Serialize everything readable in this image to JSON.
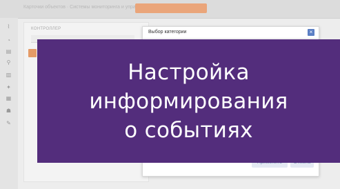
{
  "background_app": {
    "breadcrumb": "Карточки объектов · Системы мониторинга и управления",
    "panel_label": "КОНТРОЛЛЕР",
    "sidebar_icons": [
      "chart-icon",
      "gauge-icon",
      "list-icon",
      "map-pin-icon",
      "bar-chart-icon",
      "group-icon",
      "grid-icon",
      "users-icon",
      "wrench-icon"
    ]
  },
  "modal": {
    "title": "Выбор категории",
    "close_label": "×",
    "apply_label": "Применить",
    "cancel_label": "Отмена"
  },
  "overlay": {
    "line1": "Настройка",
    "line2": "информирования",
    "line3": "о событиях"
  },
  "colors": {
    "overlay_bg": "#532d7c",
    "accent_orange": "#e59b67",
    "modal_close": "#5b7fc4"
  }
}
